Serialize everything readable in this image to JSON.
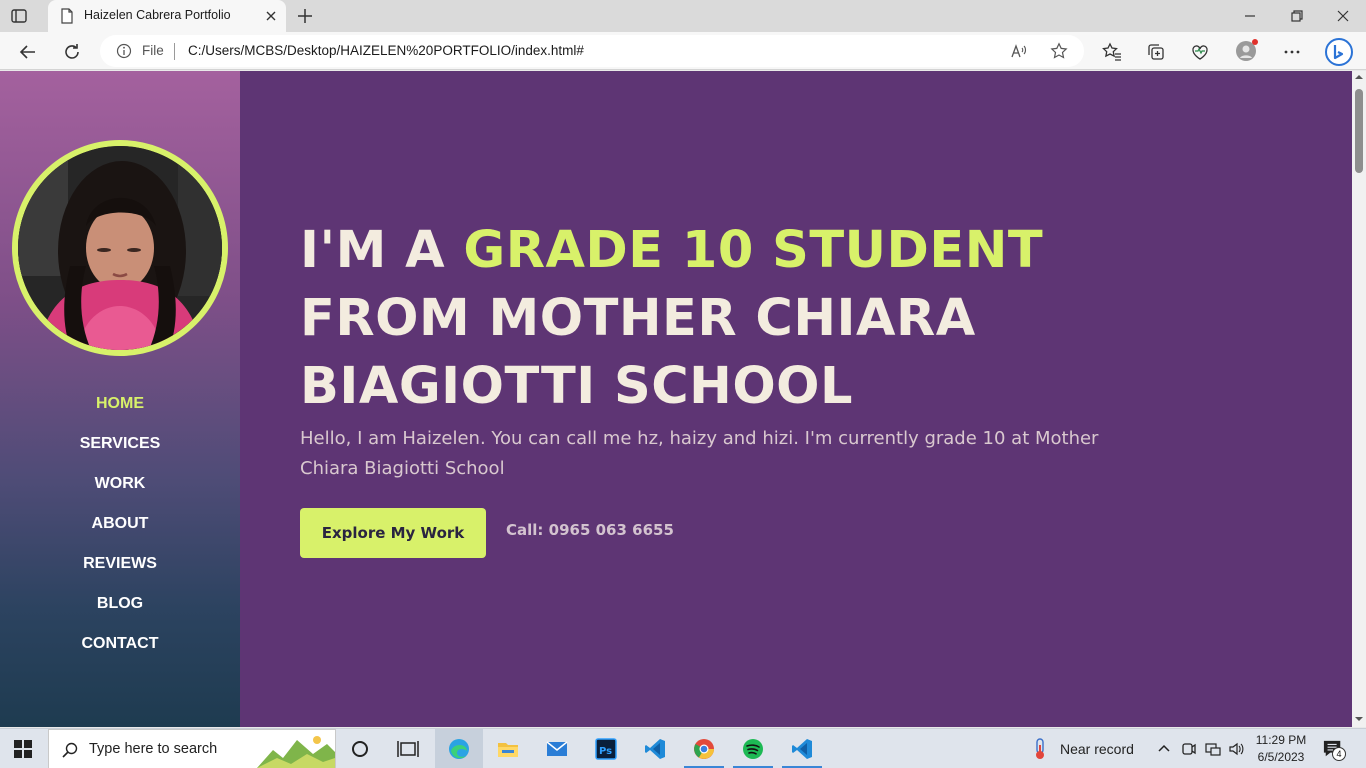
{
  "browser": {
    "tab": {
      "title": "Haizelen Cabrera Portfolio"
    },
    "address": {
      "scheme_label": "File",
      "url": "C:/Users/MCBS/Desktop/HAIZELEN%20PORTFOLIO/index.html#"
    }
  },
  "sidebar": {
    "menu": [
      {
        "label": "HOME",
        "active": true
      },
      {
        "label": "SERVICES",
        "active": false
      },
      {
        "label": "WORK",
        "active": false
      },
      {
        "label": "ABOUT",
        "active": false
      },
      {
        "label": "REVIEWS",
        "active": false
      },
      {
        "label": "BLOG",
        "active": false
      },
      {
        "label": "CONTACT",
        "active": false
      }
    ]
  },
  "hero": {
    "headline_prefix": "I'M A ",
    "headline_highlight": "GRADE 10 STUDENT",
    "headline_rest": " FROM MOTHER CHIARA BIAGIOTTI SCHOOL",
    "intro": "Hello, I am Haizelen. You can call me hz, haizy and hizi. I'm currently grade 10 at Mother Chiara Biagiotti School",
    "cta_label": "Explore My Work",
    "phone": "Call: 0965 063 6655"
  },
  "colors": {
    "accent": "#d8f16a",
    "main_bg": "#5e3574",
    "headline": "#f3ecdf"
  },
  "taskbar": {
    "search_placeholder": "Type here to search",
    "weather": "Near record",
    "time": "11:29 PM",
    "date": "6/5/2023",
    "notification_count": "4"
  }
}
